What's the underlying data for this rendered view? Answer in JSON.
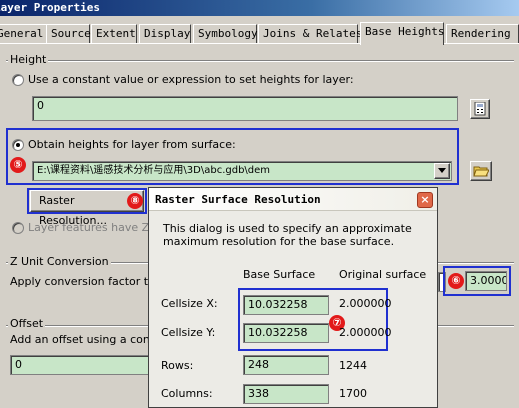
{
  "window": {
    "title": "Layer Properties"
  },
  "tabs": [
    "General",
    "Source",
    "Extent",
    "Display",
    "Symbology",
    "Joins & Relates",
    "Base Heights",
    "Rendering"
  ],
  "height_group": {
    "label": "Height",
    "constant_option": "Use a constant value or expression to set heights for layer:",
    "constant_value": "0",
    "surface_option": "Obtain heights for layer from surface:",
    "surface_path": "E:\\课程资料\\遥感技术分析与应用\\3D\\abc.gdb\\dem",
    "raster_button": "Raster Resolution...",
    "z_values_option": "Layer features have Z values. Use them for heights"
  },
  "z_unit_group": {
    "label": "Z Unit Conversion",
    "factor_label": "Apply conversion factor to place",
    "factor_value": "3.0000"
  },
  "offset_group": {
    "label": "Offset",
    "offset_label": "Add an offset using a constant",
    "offset_value": "0"
  },
  "dialog": {
    "title": "Raster Surface Resolution",
    "description_line1": "This dialog is used to specify an approximate",
    "description_line2": "maximum resolution for the base surface.",
    "col_base": "Base Surface",
    "col_original": "Original surface",
    "rows": [
      {
        "label": "Cellsize X:",
        "base": "10.032258",
        "original": "2.000000"
      },
      {
        "label": "Cellsize Y:",
        "base": "10.032258",
        "original": "2.000000"
      },
      {
        "label": "Rows:",
        "base": "248",
        "original": "1244"
      },
      {
        "label": "Columns:",
        "base": "338",
        "original": "1700"
      }
    ],
    "close_glyph": "×"
  },
  "annotations": [
    "⑤",
    "⑥",
    "⑦",
    "⑧"
  ],
  "colors": {
    "highlight": "#2030d0",
    "marker": "#e21a1a",
    "field_green": "#c8e6c8"
  }
}
